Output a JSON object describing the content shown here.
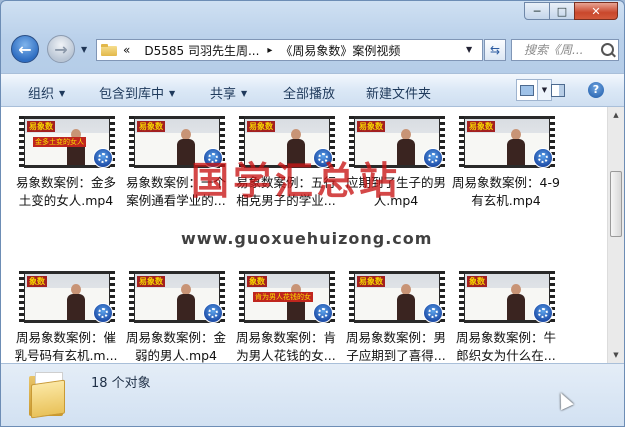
{
  "window": {
    "minimize_glyph": "─",
    "maximize_glyph": "□",
    "close_glyph": "✕"
  },
  "nav": {
    "back_glyph": "←",
    "forward_glyph": "→",
    "address": {
      "overflow_glyph": "«",
      "segment_1": "D5585 司羽先生周...",
      "separator": "▸",
      "segment_2": "《周易象数》案例视频"
    },
    "refresh_glyph": "⇆",
    "search_placeholder": "搜索《周..."
  },
  "toolbar": {
    "organize": "组织",
    "include_in_library": "包含到库中",
    "share": "共享",
    "play_all": "全部播放",
    "new_folder": "新建文件夹",
    "help_glyph": "?"
  },
  "files": [
    {
      "label": "易象数案例：金多土变的女人.mp4",
      "tag": "易象数",
      "caption": "金多土变的女人"
    },
    {
      "label": "易象数案例：一个案例通看学业的...",
      "tag": "易象数",
      "caption": ""
    },
    {
      "label": "易象数案例：五行相克男子的学业...",
      "tag": "易象数",
      "caption": ""
    },
    {
      "label": "应期到了生子的男人.mp4",
      "tag": "易象数",
      "caption": ""
    },
    {
      "label": "周易象数案例：4-9有玄机.mp4",
      "tag": "易象数",
      "caption": ""
    },
    {
      "label": "周易象数案例：催乳号码有玄机.m...",
      "tag": "象数",
      "caption": ""
    },
    {
      "label": "周易象数案例：金弱的男人.mp4",
      "tag": "易象数",
      "caption": ""
    },
    {
      "label": "周易象数案例：肯为男人花钱的女...",
      "tag": "象数",
      "caption": "肯为男人花钱的女"
    },
    {
      "label": "周易象数案例：男子应期到了喜得...",
      "tag": "易象数",
      "caption": ""
    },
    {
      "label": "周易象数案例：牛郎织女为什么在...",
      "tag": "象数",
      "caption": ""
    }
  ],
  "watermark": {
    "title": "国学汇总站",
    "url": "www.guoxuehuizong.com"
  },
  "status": {
    "count": "18 个对象"
  },
  "scrollbar": {
    "up_glyph": "▲",
    "down_glyph": "▼"
  }
}
